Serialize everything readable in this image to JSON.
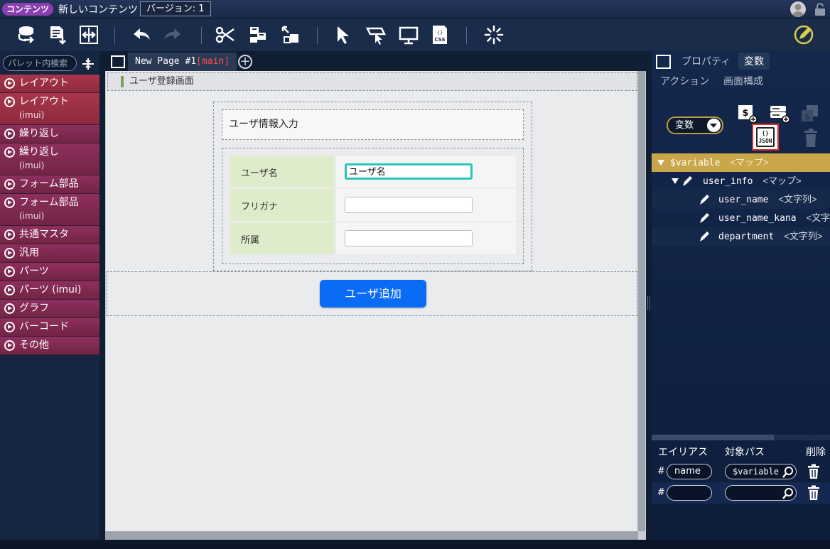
{
  "titlebar": {
    "badge": "コンテンツ",
    "title": "新しいコンテンツ",
    "version": "バージョン: 1"
  },
  "toolbar": {
    "icons": [
      "database-import-icon",
      "document-download-icon",
      "swap-icon",
      "undo-icon",
      "redo-icon",
      "cut-icon",
      "component-icon",
      "transform-icon",
      "pointer-icon",
      "hover-pointer-icon",
      "monitor-icon",
      "css-icon",
      "loading-icon",
      "edit-pencil-icon"
    ]
  },
  "palette": {
    "search_placeholder": "パレット内検索",
    "items": [
      {
        "label": "レイアウト",
        "sub": ""
      },
      {
        "label": "レイアウト",
        "sub": "(imui)"
      },
      {
        "label": "繰り返し",
        "sub": ""
      },
      {
        "label": "繰り返し",
        "sub": "(imui)"
      },
      {
        "label": "フォーム部品",
        "sub": ""
      },
      {
        "label": "フォーム部品",
        "sub": "(imui)"
      },
      {
        "label": "共通マスタ",
        "sub": ""
      },
      {
        "label": "汎用",
        "sub": ""
      },
      {
        "label": "パーツ",
        "sub": ""
      },
      {
        "label": "パーツ (imui)",
        "sub": ""
      },
      {
        "label": "グラフ",
        "sub": ""
      },
      {
        "label": "バーコード",
        "sub": ""
      },
      {
        "label": "その他",
        "sub": ""
      }
    ]
  },
  "tabs": {
    "page_name": "New Page #1",
    "page_tag": "[main]"
  },
  "canvas": {
    "page_header": "ユーザ登録画面",
    "form_title": "ユーザ情報入力",
    "fields": [
      {
        "label": "ユーザ名",
        "value": "ユーザ名"
      },
      {
        "label": "フリガナ",
        "value": ""
      },
      {
        "label": "所属",
        "value": ""
      }
    ],
    "add_button": "ユーザ追加"
  },
  "right_panel": {
    "tabs": {
      "properties": "プロパティ",
      "variables": "変数",
      "actions": "アクション",
      "screen_structure": "画面構成"
    },
    "var_select": "変数",
    "json_label": "JSON",
    "json_braces": "{}",
    "tree": [
      {
        "name": "$variable",
        "type": "<マップ>"
      },
      {
        "name": "user_info",
        "type": "<マップ>"
      },
      {
        "name": "user_name",
        "type": "<文字列>"
      },
      {
        "name": "user_name_kana",
        "type": "<文字列>"
      },
      {
        "name": "department",
        "type": "<文字列>"
      }
    ],
    "alias_headers": {
      "alias": "エイリアス",
      "path": "対象パス",
      "delete": "削除"
    },
    "alias_rows": [
      {
        "hash": "#",
        "alias": "name",
        "path": "$variable"
      },
      {
        "hash": "#",
        "alias": "",
        "path": ""
      }
    ]
  },
  "colors": {
    "accent_yellow": "#c9a64a",
    "button_blue": "#0a6cf5",
    "palette_magenta": "#8e2f5e",
    "json_highlight": "#e02a2a",
    "focus_teal": "#29c4bb"
  }
}
